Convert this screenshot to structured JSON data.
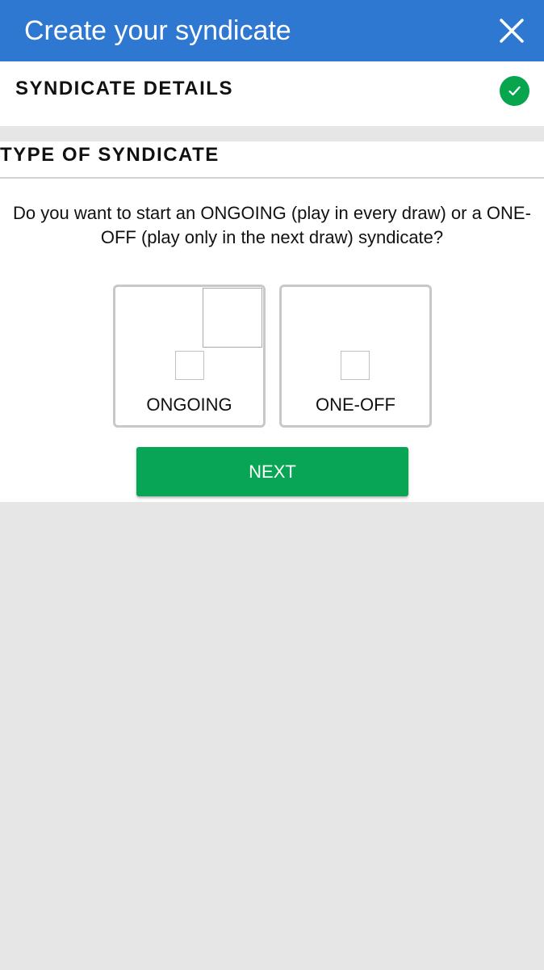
{
  "header": {
    "title": "Create your syndicate",
    "close_icon": "close-icon",
    "background_color": "#2f78d1"
  },
  "details": {
    "title": "SYNDICATE DETAILS",
    "status_icon": "checkmark-circle-icon",
    "status_color": "#08a54f"
  },
  "type": {
    "title": "TYPE OF SYNDICATE",
    "question": "Do you want to start an ONGOING (play in every draw) or a ONE-OFF (play only in the next draw) syndicate?",
    "options": [
      {
        "label": "ONGOING"
      },
      {
        "label": "ONE-OFF"
      }
    ]
  },
  "actions": {
    "next_label": "NEXT",
    "next_color": "#08a654"
  }
}
